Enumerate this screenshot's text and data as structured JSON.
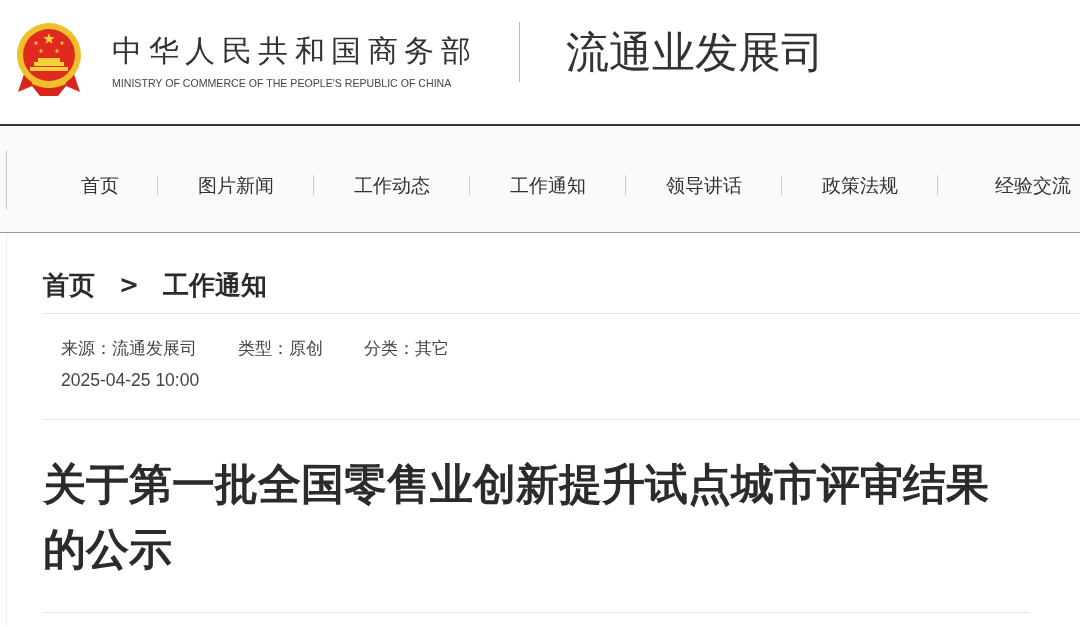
{
  "header": {
    "title": "中华人民共和国商务部",
    "subtitle": "MINISTRY OF COMMERCE OF THE PEOPLE'S REPUBLIC OF CHINA",
    "department": "流通业发展司"
  },
  "nav": {
    "items": [
      {
        "label": "首页"
      },
      {
        "label": "图片新闻"
      },
      {
        "label": "工作动态"
      },
      {
        "label": "工作通知"
      },
      {
        "label": "领导讲话"
      },
      {
        "label": "政策法规"
      },
      {
        "label": "经验交流"
      }
    ]
  },
  "breadcrumb": {
    "items": [
      {
        "label": "首页"
      },
      {
        "label": "工作通知"
      }
    ],
    "separator": ">"
  },
  "meta": {
    "fields": [
      "来源：流通发展司",
      "类型：原创",
      "分类：其它"
    ],
    "date": "2025-04-25 10:00"
  },
  "article": {
    "title": "关于第一批全国零售业创新提升试点城市评审结果的公示"
  }
}
